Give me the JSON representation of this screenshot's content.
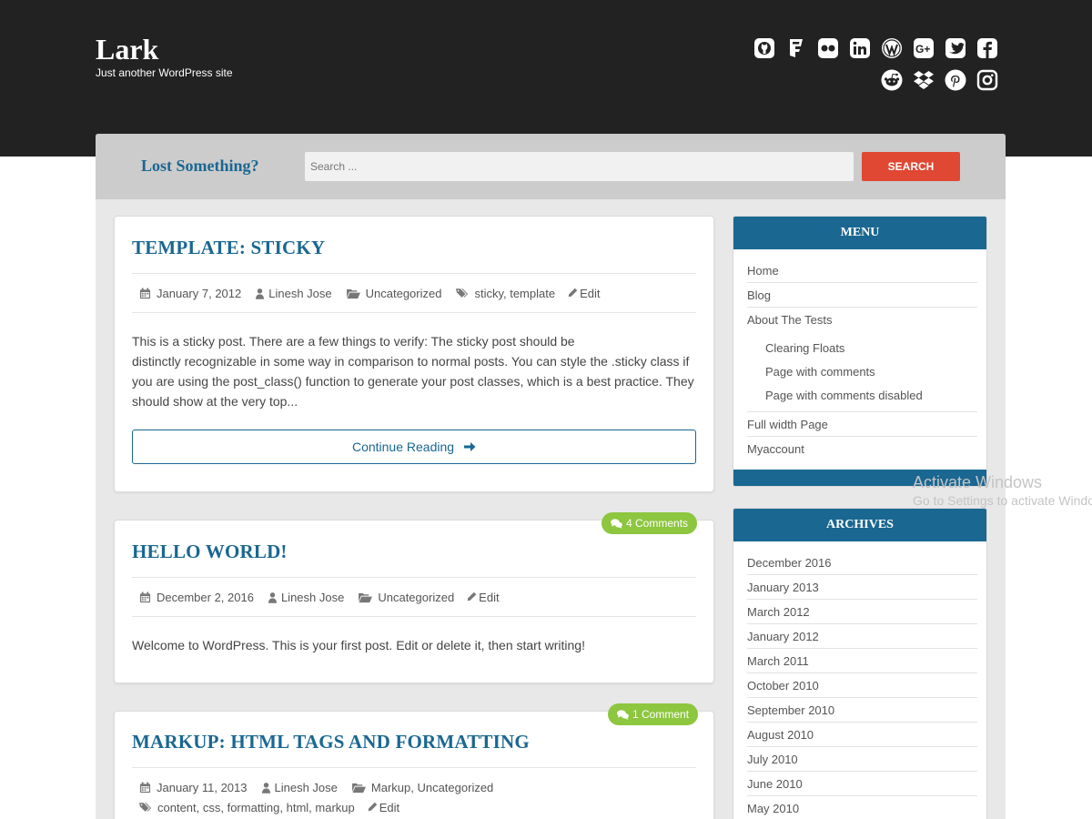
{
  "site": {
    "title": "Lark",
    "description": "Just another WordPress site"
  },
  "social_icons": [
    "github-icon",
    "foursquare-icon",
    "flickr-icon",
    "linkedin-icon",
    "wordpress-icon",
    "google-plus-icon",
    "twitter-icon",
    "facebook-icon",
    "reddit-icon",
    "dropbox-icon",
    "pinterest-icon",
    "instagram-icon"
  ],
  "search": {
    "heading": "Lost Something?",
    "placeholder": "Search ...",
    "button_label": "SEARCH"
  },
  "posts": [
    {
      "title": "TEMPLATE: STICKY",
      "date": "January 7, 2012",
      "author": "Linesh Jose",
      "category": "Uncategorized",
      "tags": "sticky, template",
      "edit": "Edit",
      "excerpt_lines": [
        "This is a sticky post. There are a few things to verify: The sticky post should be",
        "distinctly recognizable in some way in comparison to normal posts. You can style the .sticky class if",
        "you are using the post_class() function to generate your post classes, which is a best practice. They",
        "should show at the very top..."
      ],
      "continue_label": "Continue Reading"
    },
    {
      "title": "HELLO WORLD!",
      "comments": "4 Comments",
      "date": "December 2, 2016",
      "author": "Linesh Jose",
      "category": "Uncategorized",
      "edit": "Edit",
      "excerpt": "Welcome to WordPress. This is your first post. Edit or delete it, then start writing!"
    },
    {
      "title": "MARKUP: HTML TAGS AND FORMATTING",
      "comments": "1 Comment",
      "date": "January 11, 2013",
      "author": "Linesh Jose",
      "category": "Markup, Uncategorized",
      "tags": "content, css, formatting, html, markup",
      "edit": "Edit"
    }
  ],
  "menu_widget": {
    "title": "MENU",
    "items": [
      "Home",
      "Blog",
      "About The Tests"
    ],
    "subitems": [
      "Clearing Floats",
      "Page with comments",
      "Page with comments disabled"
    ],
    "items_after": [
      "Full width Page",
      "Myaccount"
    ]
  },
  "archives_widget": {
    "title": "ARCHIVES",
    "items": [
      "December 2016",
      "January 2013",
      "March 2012",
      "January 2012",
      "March 2011",
      "October 2010",
      "September 2010",
      "August 2010",
      "July 2010",
      "June 2010",
      "May 2010"
    ]
  },
  "watermark": {
    "line1": "Activate Windows",
    "line2": "Go to Settings to activate Windows."
  },
  "colors": {
    "header_bg": "#222222",
    "accent_blue": "#1a6791",
    "search_button": "#e04833",
    "comment_badge": "#8dc63f"
  }
}
